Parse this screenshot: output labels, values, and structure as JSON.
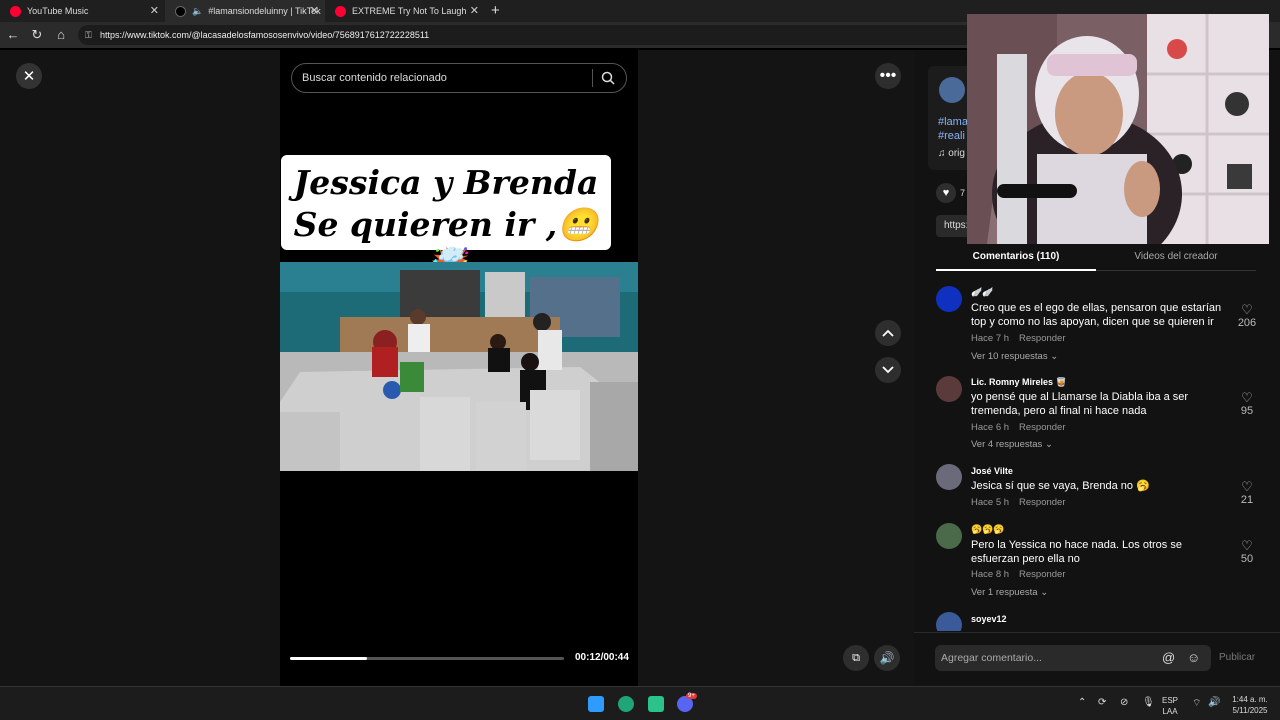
{
  "browser": {
    "tabs": [
      {
        "label": "YouTube Music",
        "color": "#ff0033"
      },
      {
        "label": "#lamansiondeluinny | TikTok",
        "color": "#ffffff"
      },
      {
        "label": "EXTREME Try Not To Laugh",
        "color": "#ff0033"
      }
    ],
    "new_tab_label": "+",
    "url": "https://www.tiktok.com/@lacasadelosfamososenvivo/video/7568917612722228511"
  },
  "video": {
    "search_placeholder": "Buscar contenido relacionado",
    "caption_line1": "Jessica y Brenda",
    "caption_line2": "Se quieren ir ,😬🤯",
    "progress": 0.28,
    "time": "00:12/00:44"
  },
  "creator_partial": {
    "hashtag1": "#lama",
    "hashtag2": "#reali",
    "sound": "♫ orig",
    "likes": "7",
    "link": "https:"
  },
  "panel": {
    "tab_comments": "Comentarios (110)",
    "tab_creator": "Videos del creador",
    "comment_placeholder": "Agregar comentario...",
    "publish": "Publicar"
  },
  "comments": [
    {
      "name": "🪽🪽",
      "text": "Creo que es el ego de ellas, pensaron que estarían top y como no las apoyan, dicen que se quieren ir",
      "time": "Hace 7 h",
      "reply": "Responder",
      "replies": "Ver 10 respuestas",
      "likes": "206",
      "avatar": "#1030c0"
    },
    {
      "name": "Lic. Romny Mireles 🥃",
      "text": "yo pensé que al Llamarse la Diabla iba a ser tremenda, pero al final ni hace nada",
      "time": "Hace 6 h",
      "reply": "Responder",
      "replies": "Ver 4 respuestas",
      "likes": "95",
      "avatar": "#5a3a3a"
    },
    {
      "name": "José Vilte",
      "text": "Jesica sí que se vaya, Brenda no 🥱",
      "time": "Hace 5 h",
      "reply": "Responder",
      "replies": "",
      "likes": "21",
      "avatar": "#6a6a7a"
    },
    {
      "name": "🥱🥱🥱",
      "text": "Pero la Yessica no hace nada. Los otros se esfuerzan pero ella no",
      "time": "Hace 8 h",
      "reply": "Responder",
      "replies": "Ver 1 respuesta",
      "likes": "50",
      "avatar": "#4a6a4a"
    },
    {
      "name": "soyev12",
      "text": "",
      "time": "",
      "reply": "",
      "replies": "",
      "likes": "",
      "avatar": "#3a5a9a"
    }
  ],
  "taskbar": {
    "lang1": "ESP",
    "lang2": "LAA",
    "time": "1:44 a. m.",
    "date": "5/11/2025",
    "discord_badge": "9+"
  }
}
